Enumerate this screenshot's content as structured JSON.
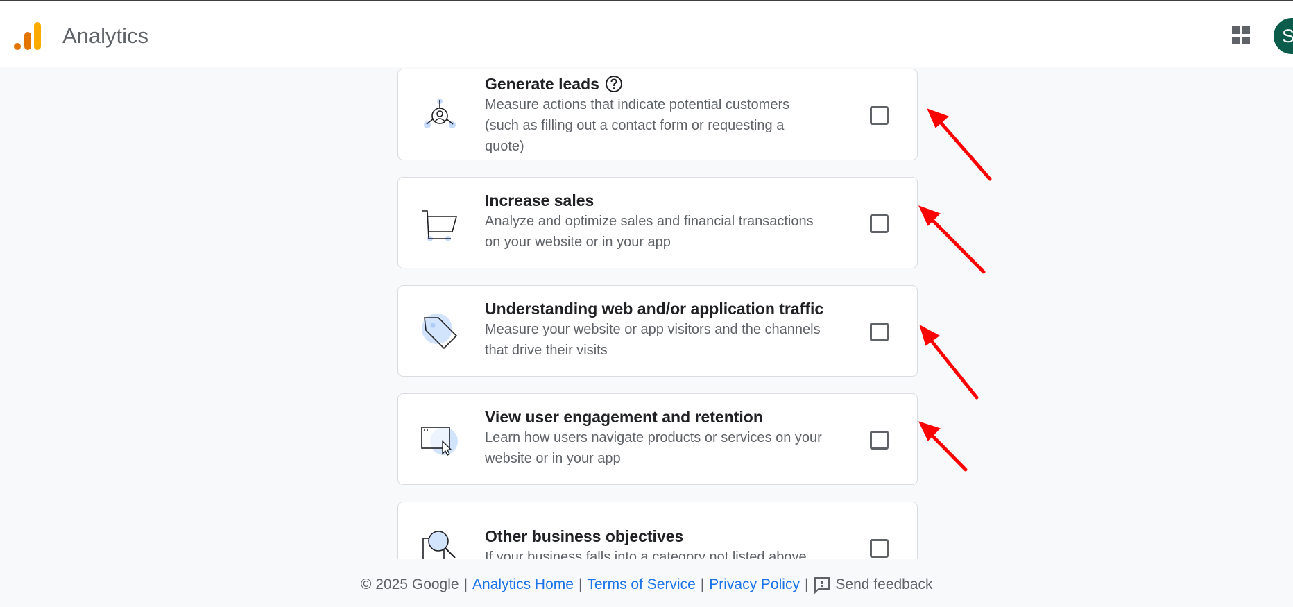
{
  "header": {
    "app_title": "Analytics",
    "avatar_initial": "S",
    "brand_colors": {
      "logo_dark": "#e37400",
      "logo_light": "#f9ab00",
      "avatar_bg": "#0b5c4a"
    }
  },
  "objectives": [
    {
      "title": "Generate leads",
      "desc_lines": [
        "Measure actions that indicate potential customers",
        "(such as filling out a contact form or requesting a",
        "quote)"
      ],
      "icon": "leads-icon",
      "has_help": true,
      "checked": false
    },
    {
      "title": "Increase sales",
      "desc_lines": [
        "Analyze and optimize sales and financial transactions",
        "on your website or in your app"
      ],
      "icon": "cart-icon",
      "has_help": false,
      "checked": false
    },
    {
      "title": "Understanding web and/or application traffic",
      "desc_lines": [
        "Measure your website or app visitors and the channels",
        "that drive their visits"
      ],
      "icon": "tag-icon",
      "has_help": false,
      "checked": false
    },
    {
      "title": "View user engagement and retention",
      "desc_lines": [
        "Learn how users navigate products or services on your",
        "website or in your app"
      ],
      "icon": "window-cursor-icon",
      "has_help": false,
      "checked": false
    },
    {
      "title": "Other business objectives",
      "desc_lines": [
        "If your business falls into a category not listed above"
      ],
      "icon": "magnifier-icon",
      "has_help": false,
      "checked": false
    }
  ],
  "footer": {
    "copyright": "© 2025 Google",
    "separator": "|",
    "analytics_home": "Analytics Home",
    "terms": "Terms of Service",
    "privacy": "Privacy Policy",
    "feedback": "Send feedback"
  },
  "annotation_color": "#ff0000"
}
